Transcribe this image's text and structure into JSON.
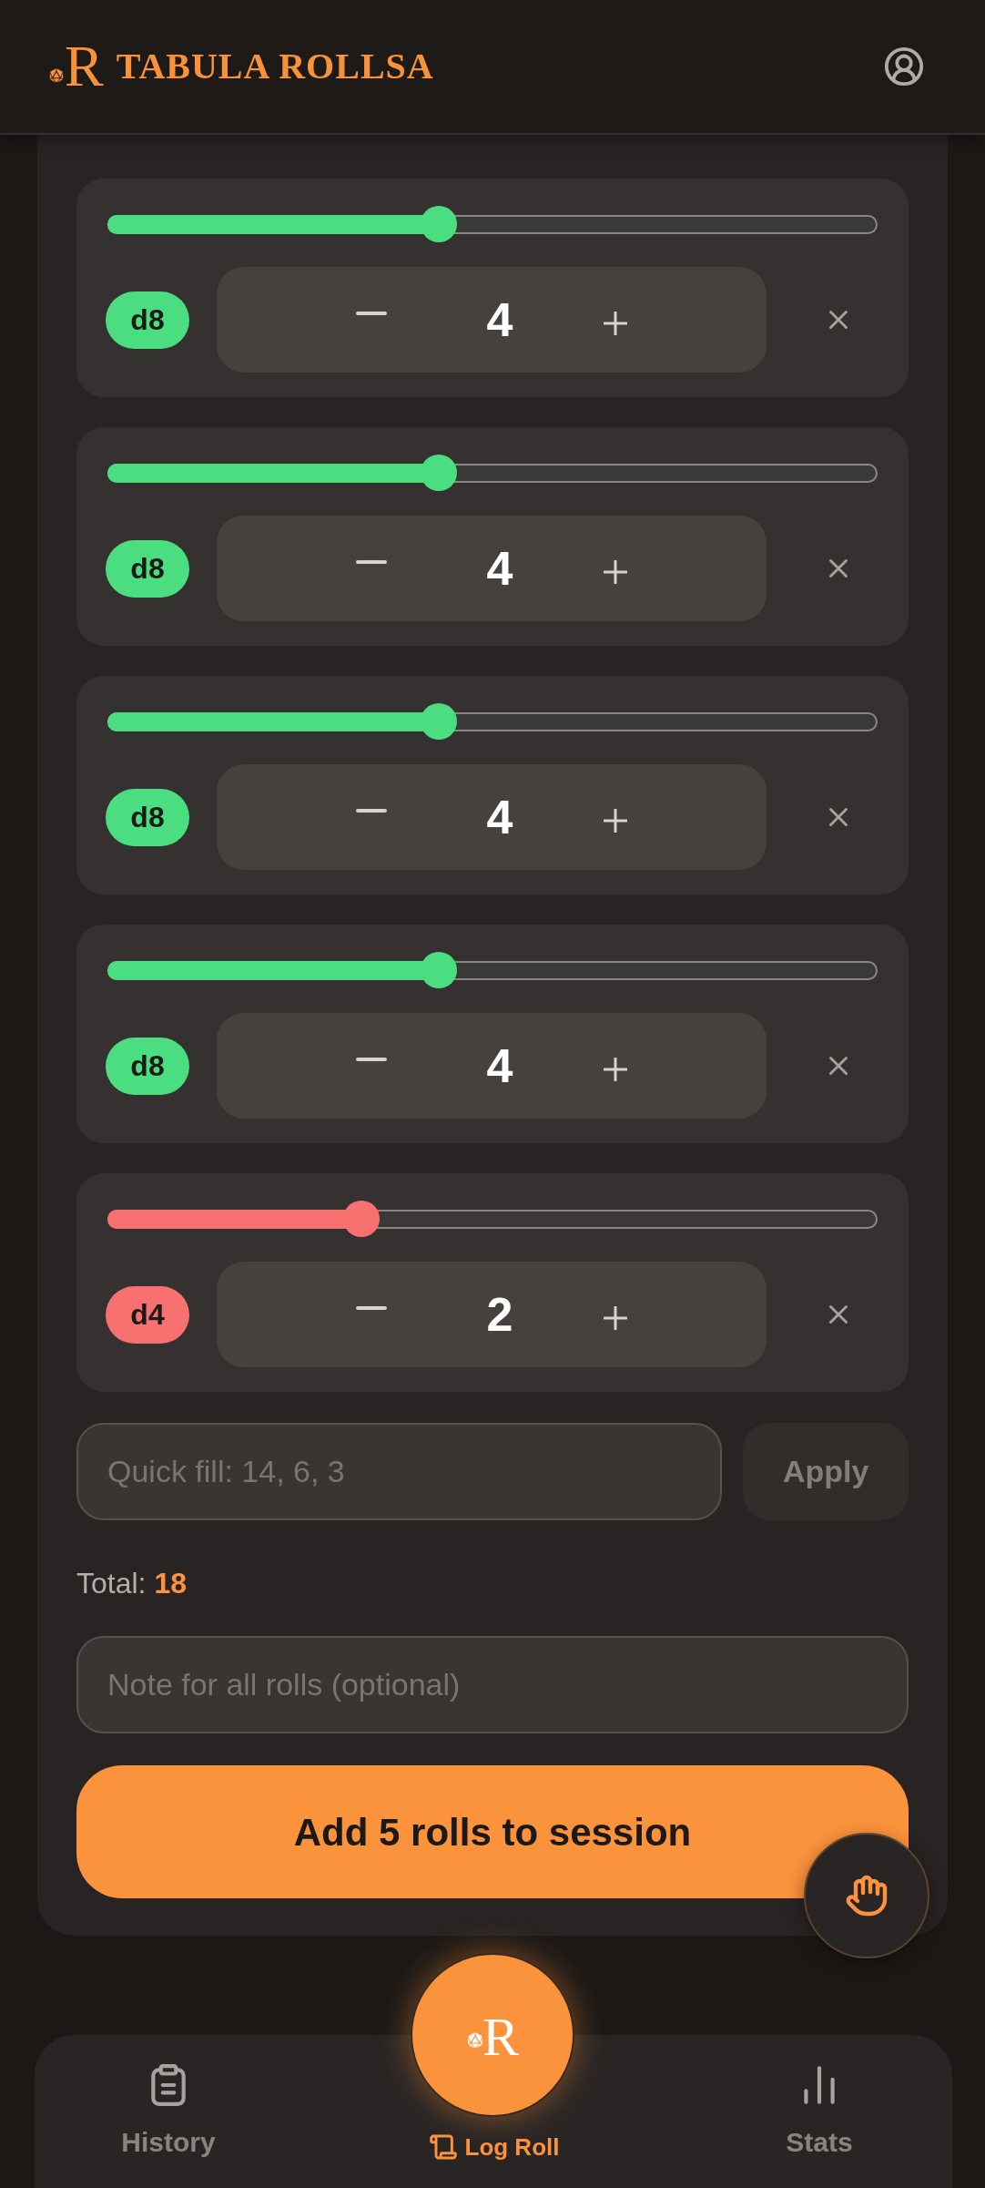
{
  "header": {
    "logo": "R",
    "title": "TABULA ROLLSA"
  },
  "dice": [
    {
      "die": "d8",
      "color": "#4ade80",
      "level": 0.43,
      "value": "4"
    },
    {
      "die": "d8",
      "color": "#4ade80",
      "level": 0.43,
      "value": "4"
    },
    {
      "die": "d8",
      "color": "#4ade80",
      "level": 0.43,
      "value": "4"
    },
    {
      "die": "d8",
      "color": "#4ade80",
      "level": 0.43,
      "value": "4"
    },
    {
      "die": "d4",
      "color": "#f87171",
      "level": 0.33,
      "value": "2"
    }
  ],
  "quick_fill": {
    "placeholder": "Quick fill: 14, 6, 3",
    "button": {
      "label": "Apply",
      "disabled": true
    }
  },
  "total": {
    "label": "Total:",
    "value": "18"
  },
  "note": {
    "placeholder": "Note for all rolls (optional)"
  },
  "submit": {
    "label": "Add 5 rolls to session"
  },
  "fab": {
    "logo": "R"
  },
  "nav": [
    {
      "kind": "tab",
      "label": "History",
      "selected": false
    },
    {
      "kind": "center",
      "label": "Log Roll",
      "selected": true
    },
    {
      "kind": "tab",
      "label": "Stats",
      "selected": false
    }
  ]
}
